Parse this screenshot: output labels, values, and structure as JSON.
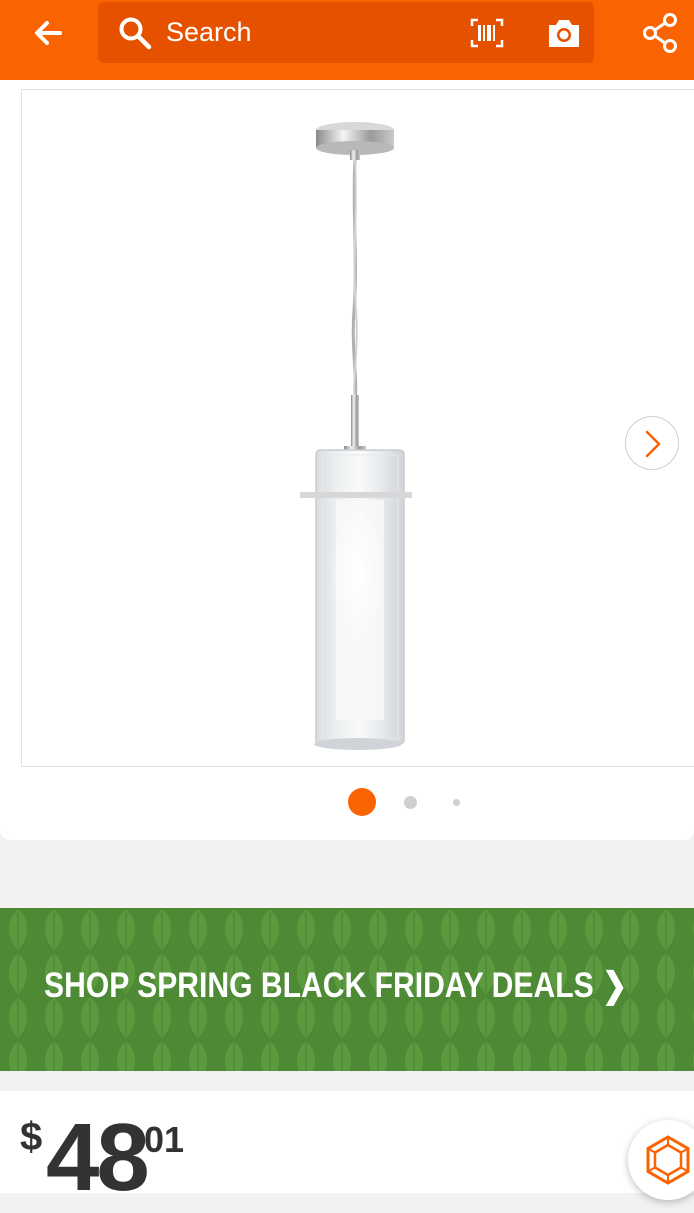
{
  "header": {
    "search": {
      "placeholder": "Search"
    },
    "icons": {
      "back": "arrow-back-icon",
      "search": "search-icon",
      "barcode": "barcode-scan-icon",
      "camera": "camera-icon",
      "share": "share-icon"
    },
    "accent": "#f96302"
  },
  "gallery": {
    "image": "product-image-pendant-light",
    "next_icon": "chevron-right-icon",
    "page_count": 3,
    "active_index": 0
  },
  "promo": {
    "text": "SHOP SPRING BLACK FRIDAY DEALS ❯",
    "background": "#4e8a35"
  },
  "price": {
    "currency": "$",
    "dollars": "48",
    "cents": "01"
  },
  "assistant": {
    "icon": "hexagon-assistant-icon"
  }
}
